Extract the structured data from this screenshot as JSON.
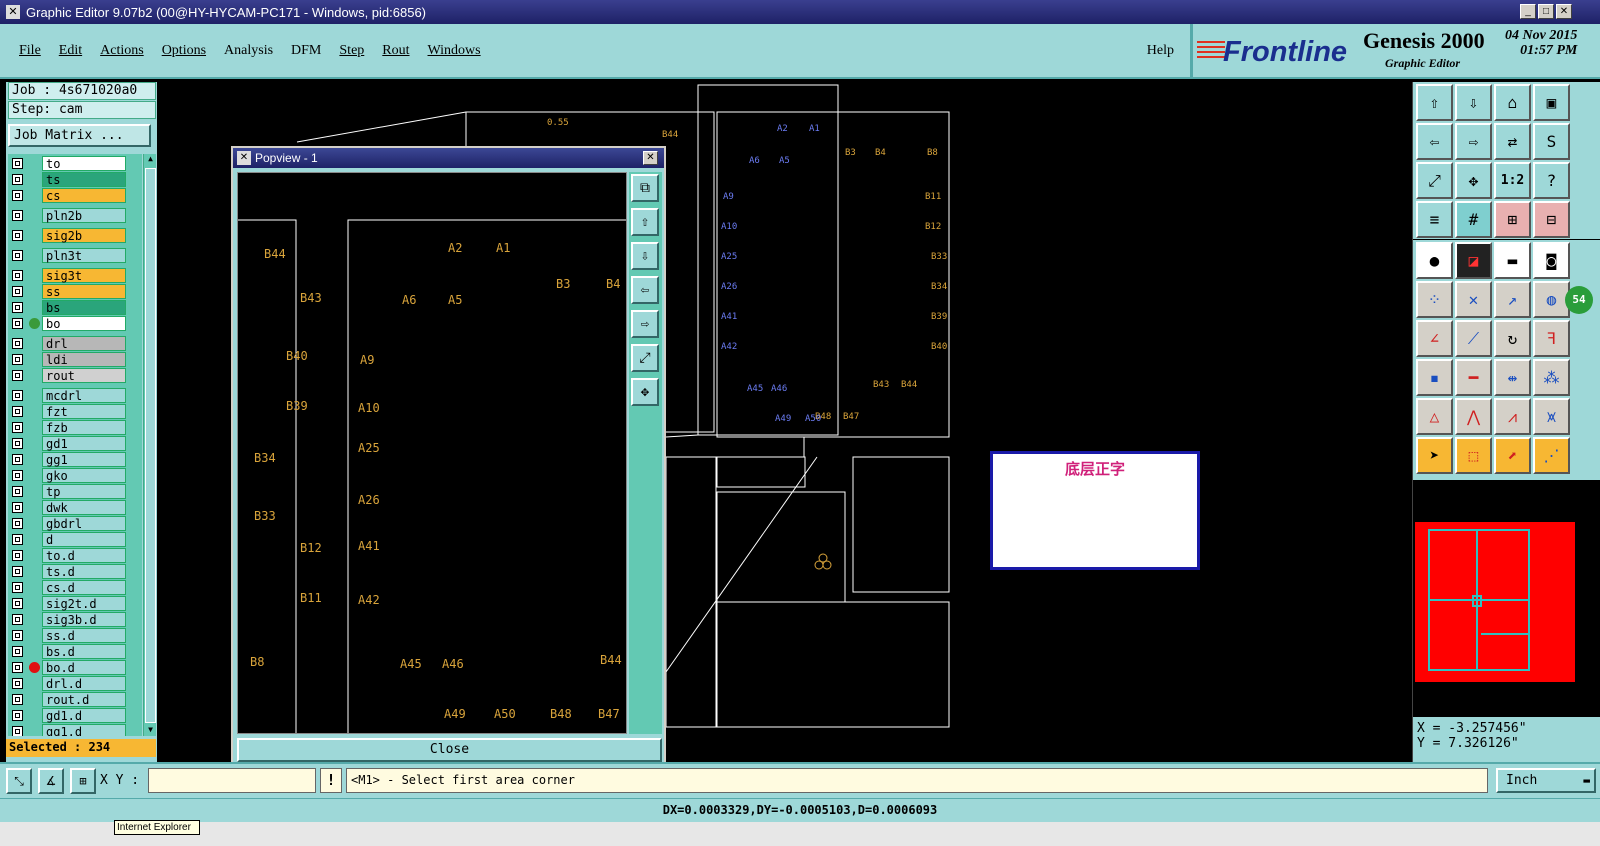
{
  "window": {
    "title": "Graphic Editor 9.07b2 (00@HY-HYCAM-PC171 - Windows, pid:6856)"
  },
  "menu": {
    "items": [
      "File",
      "Edit",
      "Actions",
      "Options",
      "Analysis",
      "DFM",
      "Step",
      "Rout",
      "Windows"
    ],
    "help": "Help"
  },
  "brand": {
    "logo": "Frontline",
    "product": "Genesis 2000",
    "subtitle": "Graphic Editor",
    "date": "04 Nov 2015",
    "time": "01:57 PM"
  },
  "job": {
    "job_label": "Job : 4s671020a0",
    "step_label": "Step: cam",
    "matrix_button": "Job Matrix ..."
  },
  "layers": [
    {
      "name": "to",
      "color": "#ffffff"
    },
    {
      "name": "ts",
      "color": "#2aa57b"
    },
    {
      "name": "cs",
      "color": "#f7b733"
    },
    {
      "name": "pln2b",
      "color": "#9ed8d8"
    },
    {
      "name": "sig2b",
      "color": "#f7b733"
    },
    {
      "name": "pln3t",
      "color": "#9ed8d8"
    },
    {
      "name": "sig3t",
      "color": "#f7b733"
    },
    {
      "name": "ss",
      "color": "#f7b733"
    },
    {
      "name": "bs",
      "color": "#2aa57b"
    },
    {
      "name": "bo",
      "color": "#ffffff"
    },
    {
      "name": "drl",
      "color": "#b7b7b7"
    },
    {
      "name": "ldi",
      "color": "#b7b7b7"
    },
    {
      "name": "rout",
      "color": "#d0d0d0"
    },
    {
      "name": "mcdrl",
      "color": "#9ed8d8"
    },
    {
      "name": "fzt",
      "color": "#9ed8d8"
    },
    {
      "name": "fzb",
      "color": "#9ed8d8"
    },
    {
      "name": "gd1",
      "color": "#9ed8d8"
    },
    {
      "name": "gg1",
      "color": "#9ed8d8"
    },
    {
      "name": "gko",
      "color": "#9ed8d8"
    },
    {
      "name": "tp",
      "color": "#9ed8d8"
    },
    {
      "name": "dwk",
      "color": "#9ed8d8"
    },
    {
      "name": "gbdrl",
      "color": "#9ed8d8"
    },
    {
      "name": "d",
      "color": "#9ed8d8"
    },
    {
      "name": "to.d",
      "color": "#9ed8d8"
    },
    {
      "name": "ts.d",
      "color": "#9ed8d8"
    },
    {
      "name": "cs.d",
      "color": "#9ed8d8"
    },
    {
      "name": "sig2t.d",
      "color": "#9ed8d8"
    },
    {
      "name": "sig3b.d",
      "color": "#9ed8d8"
    },
    {
      "name": "ss.d",
      "color": "#9ed8d8"
    },
    {
      "name": "bs.d",
      "color": "#9ed8d8"
    },
    {
      "name": "bo.d",
      "color": "#9ed8d8"
    },
    {
      "name": "drl.d",
      "color": "#9ed8d8"
    },
    {
      "name": "rout.d",
      "color": "#9ed8d8"
    },
    {
      "name": "gd1.d",
      "color": "#9ed8d8"
    },
    {
      "name": "gg1.d",
      "color": "#9ed8d8"
    }
  ],
  "selected": "Selected : 234",
  "popview": {
    "title": "Popview - 1",
    "close": "Close"
  },
  "canvas": {
    "label_text": "底层正字"
  },
  "coords": {
    "x": "X = -3.257456\"",
    "y": "Y = 7.326126\""
  },
  "xy_label": "X Y :",
  "prompt": "<M1> - Select first area corner",
  "unit": "Inch",
  "status": "DX=0.0003329,DY=-0.0005103,D=0.0006093",
  "tooltip": "Internet Explorer",
  "indicator_badge": "54",
  "zoom_ratio_label": "1:2",
  "pcb_labels": {
    "a1": "A1",
    "a2": "A2",
    "a5": "A5",
    "a6": "A6",
    "a9": "A9",
    "a10": "A10",
    "a25": "A25",
    "a26": "A26",
    "a41": "A41",
    "a42": "A42",
    "a45": "A45",
    "a46": "A46",
    "a49": "A49",
    "a50": "A50",
    "b3": "B3",
    "b4": "B4",
    "b8": "B8",
    "b11": "B11",
    "b12": "B12",
    "b33": "B33",
    "b34": "B34",
    "b39": "B39",
    "b40": "B40",
    "b43": "B43",
    "b44": "B44",
    "b47": "B47",
    "b48": "B48",
    "v55": "0.55"
  }
}
